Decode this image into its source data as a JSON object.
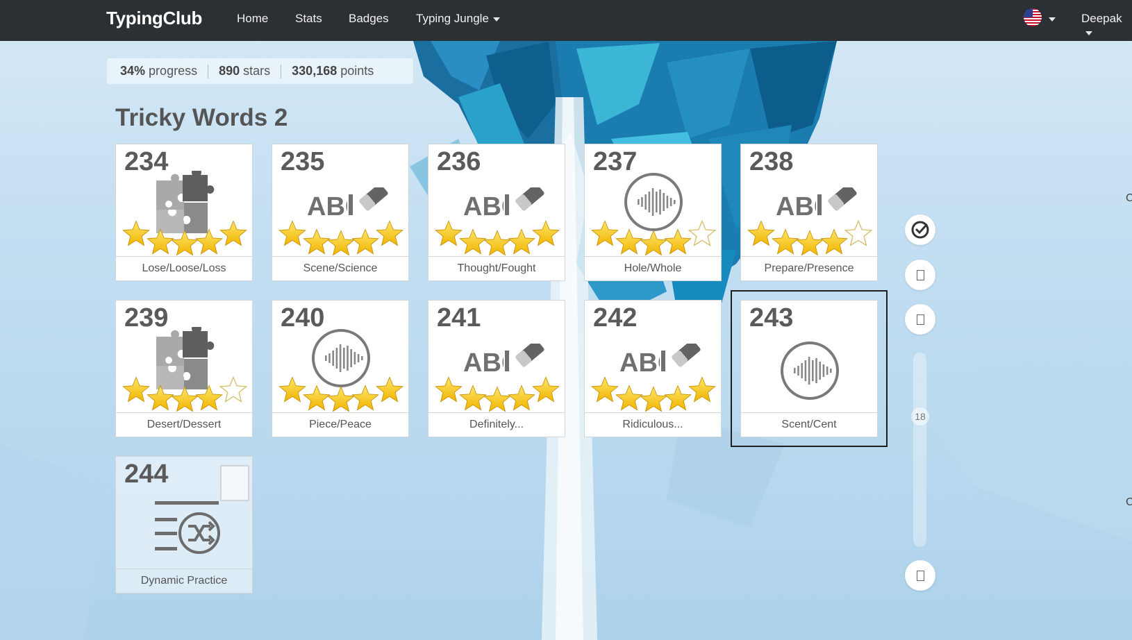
{
  "navbar": {
    "brand": "TypingClub",
    "items": [
      "Home",
      "Stats",
      "Badges"
    ],
    "jungle_label": "Typing Jungle",
    "user": "Deepak"
  },
  "stats": {
    "progress_value": "34%",
    "progress_label": "progress",
    "stars_value": "890",
    "stars_label": "stars",
    "points_value": "330,168",
    "points_label": "points"
  },
  "section_title": "Tricky Words 2",
  "lessons": [
    {
      "num": "234",
      "label": "Lose/Loose/Loss",
      "icon": "puzzle-icon",
      "stars": 5
    },
    {
      "num": "235",
      "label": "Scene/Science",
      "icon": "abc-eraser-icon",
      "stars": 5
    },
    {
      "num": "236",
      "label": "Thought/Fought",
      "icon": "abc-eraser-icon",
      "stars": 5
    },
    {
      "num": "237",
      "label": "Hole/Whole",
      "icon": "sound-wave-icon",
      "stars": 4
    },
    {
      "num": "238",
      "label": "Prepare/Presence",
      "icon": "abc-eraser-icon",
      "stars": 4
    },
    {
      "num": "239",
      "label": "Desert/Dessert",
      "icon": "puzzle-icon",
      "stars": 4
    },
    {
      "num": "240",
      "label": "Piece/Peace",
      "icon": "sound-wave-icon",
      "stars": 5
    },
    {
      "num": "241",
      "label": "Definitely...",
      "icon": "abc-eraser-icon",
      "stars": 5
    },
    {
      "num": "242",
      "label": "Ridiculous...",
      "icon": "abc-eraser-icon",
      "stars": 5
    },
    {
      "num": "243",
      "label": "Scent/Cent",
      "icon": "sound-wave-icon",
      "stars": 0
    },
    {
      "num": "244",
      "label": "Dynamic Practice",
      "icon": "shuffle-list-icon",
      "stars": 0
    }
  ],
  "abc_text": "ABC",
  "slider_value": "18",
  "colors": {
    "navbar": "#2b3034",
    "star": "#f5c518",
    "current_outline": "#1d1d1d"
  }
}
